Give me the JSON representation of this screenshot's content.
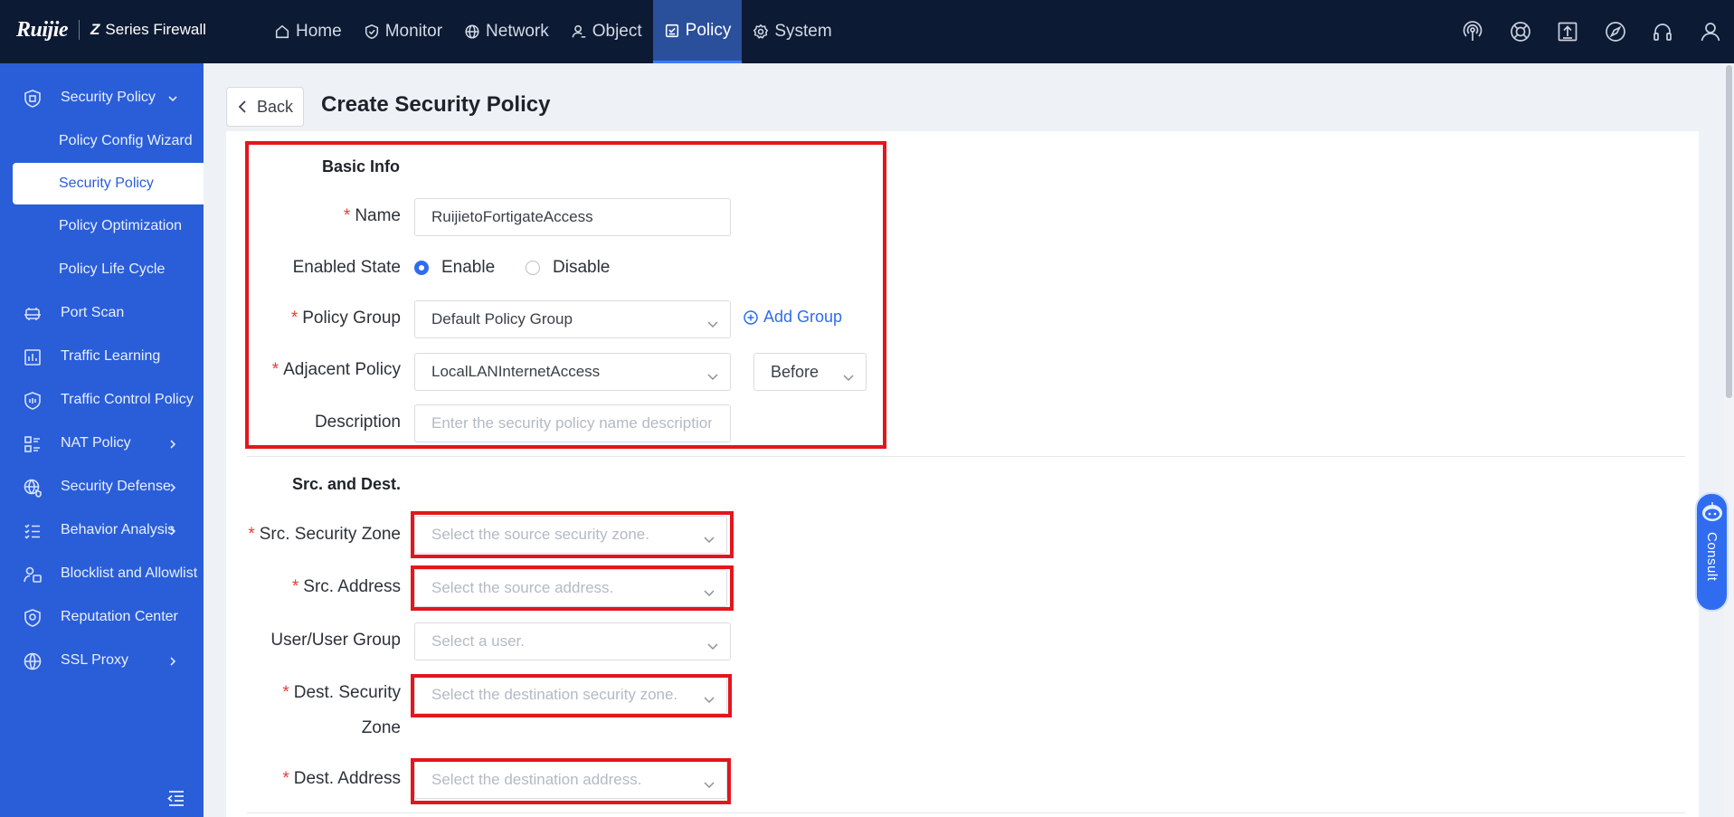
{
  "brand": {
    "logo": "Ruijie",
    "product": "Series Firewall",
    "product_mark": "Z"
  },
  "nav": [
    {
      "label": "Home",
      "icon": "home-icon"
    },
    {
      "label": "Monitor",
      "icon": "shield-icon"
    },
    {
      "label": "Network",
      "icon": "globe-icon"
    },
    {
      "label": "Object",
      "icon": "user-object-icon"
    },
    {
      "label": "Policy",
      "icon": "policy-icon",
      "active": true
    },
    {
      "label": "System",
      "icon": "gear-icon"
    }
  ],
  "top_tools": [
    "signal-icon",
    "help-lifebuoy-icon",
    "upload-icon",
    "compass-icon",
    "headset-icon",
    "user-icon"
  ],
  "sidebar": {
    "security_policy": "Security Policy",
    "subitems": [
      "Policy Config Wizard",
      "Security Policy",
      "Policy Optimization",
      "Policy Life Cycle"
    ],
    "items": [
      "Port Scan",
      "Traffic Learning",
      "Traffic Control Policy",
      "NAT Policy",
      "Security Defense",
      "Behavior Analysis",
      "Blocklist and Allowlist",
      "Reputation Center",
      "SSL Proxy"
    ]
  },
  "page": {
    "back_label": "Back",
    "title": "Create Security Policy"
  },
  "basic": {
    "title": "Basic Info",
    "name_label": "Name",
    "name_value": "RuijietoFortigateAccess",
    "enabled_label": "Enabled State",
    "enable": "Enable",
    "disable": "Disable",
    "group_label": "Policy Group",
    "group_value": "Default Policy Group",
    "add_group": "Add Group",
    "adjacent_label": "Adjacent Policy",
    "adjacent_value": "LocalLANInternetAccess",
    "position_value": "Before",
    "description_label": "Description",
    "description_placeholder": "Enter the security policy name description."
  },
  "srcdest": {
    "title": "Src. and Dest.",
    "src_zone_label": "Src. Security Zone",
    "src_zone_placeholder": "Select the source security zone.",
    "src_addr_label": "Src. Address",
    "src_addr_placeholder": "Select the source address.",
    "user_label": "User/User Group",
    "user_placeholder": "Select a user.",
    "dest_zone_label_1": "Dest. Security",
    "dest_zone_label_2": "Zone",
    "dest_zone_placeholder": "Select the destination security zone.",
    "dest_addr_label": "Dest. Address",
    "dest_addr_placeholder": "Select the destination address."
  },
  "consult": {
    "label": "Consult"
  },
  "colors": {
    "topbar": "#0d1a33",
    "sidebar": "#2a5ed8",
    "accent": "#2f6cf0",
    "highlight_box": "#e3161c",
    "required": "#e83a3a"
  }
}
